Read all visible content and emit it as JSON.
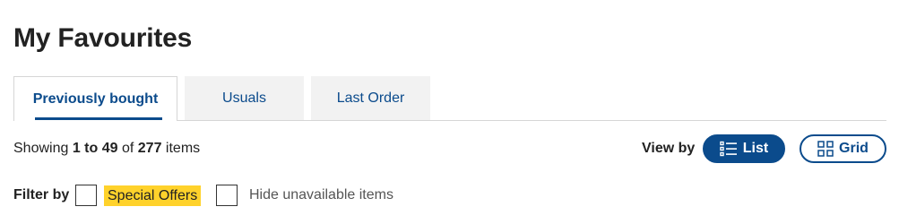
{
  "page": {
    "title": "My Favourites"
  },
  "tabs": [
    {
      "label": "Previously bought",
      "active": true
    },
    {
      "label": "Usuals",
      "active": false
    },
    {
      "label": "Last Order",
      "active": false
    }
  ],
  "results": {
    "prefix": "Showing",
    "range": "1 to 49",
    "of": "of",
    "total": "277",
    "suffix": "items"
  },
  "view": {
    "label": "View by",
    "options": [
      {
        "label": "List",
        "icon": "list-icon",
        "selected": true
      },
      {
        "label": "Grid",
        "icon": "grid-icon",
        "selected": false
      }
    ]
  },
  "filter": {
    "label": "Filter by",
    "options": [
      {
        "label": "Special Offers",
        "checked": false,
        "highlight": "#ffd22b"
      },
      {
        "label": "Hide unavailable items",
        "checked": false
      }
    ]
  },
  "colors": {
    "brand": "#0b4b8c",
    "offer_highlight": "#ffd22b",
    "tab_inactive_bg": "#f2f2f2"
  }
}
